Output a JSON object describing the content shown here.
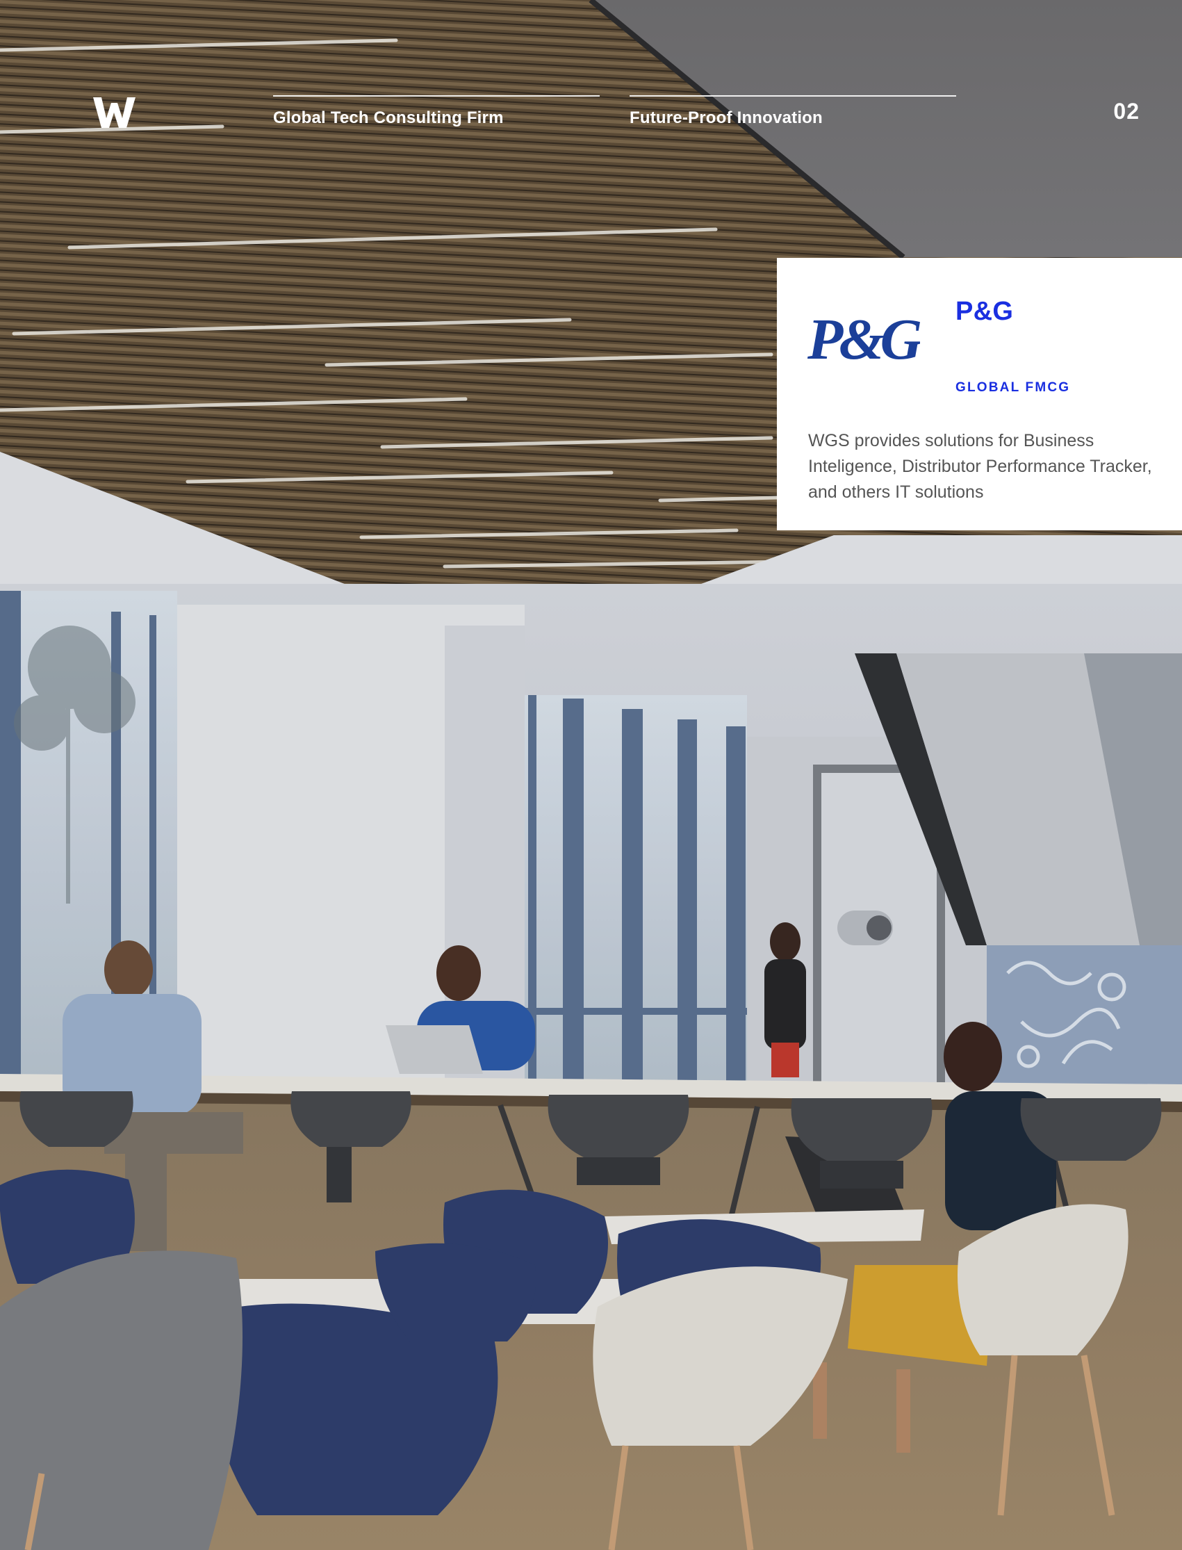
{
  "header": {
    "logo_icon": "wgs-w-logo",
    "column_1": "Global Tech Consulting Firm",
    "column_2": "Future-Proof Innovation",
    "page_number": "02"
  },
  "client_card": {
    "logo_text": "P&G",
    "name": "P&G",
    "sector": "GLOBAL FMCG",
    "description": "WGS provides solutions for Business Inteligence, Distributor Performance Tracker, and others IT solutions"
  },
  "background_image": "office-interior-photo",
  "colors": {
    "accent": "#1a2fe0",
    "text_light": "#ffffff",
    "body_text": "#555555",
    "card_bg": "#ffffff"
  }
}
